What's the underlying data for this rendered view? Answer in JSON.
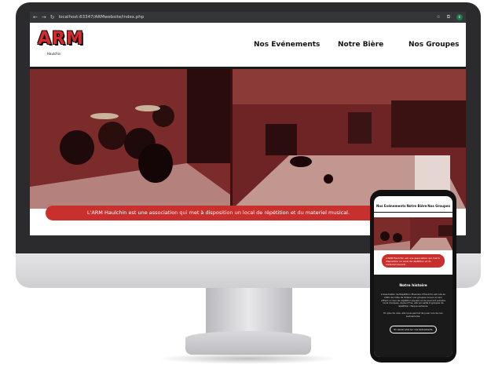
{
  "browser": {
    "url": "localhost:63347/ARMwebsite/index.php",
    "nav_icons": [
      "back-icon",
      "forward-icon",
      "reload-icon"
    ],
    "profile_initial": "c"
  },
  "site": {
    "logo": "ARM",
    "logo_sub": "Haulchin",
    "nav": [
      "Nos Evénements",
      "Notre Bière",
      "Nos Groupes"
    ],
    "banner": "L'ARM Haulchin est une association qui met à disposition un local de répétition et du materiel musical.",
    "accent": "#c8302e",
    "hero_tint": "#7a2a2a"
  },
  "mobile": {
    "nav": [
      "Nos Evénements",
      "Notre Bière",
      "Nos Groupes"
    ],
    "banner": "L'ARM Haulchin est une association qui met à disposition un local de répétition et du materiel musical.",
    "section_title": "Notre histoire",
    "para1": "L'Association de Répétition Musicale d'Haulchin est née en 2020 de l'idée de fédérer nos groupes locaux en leur offrant un lieu de répétition équipé où ils pourront prendre leurs marques. Aujourd'hui, elle accueille 6 groupes de répétition chaque semaine.",
    "para2": "En plus de cela, elle nous permet de jouer lors de nos événements.",
    "button": "En savoir plus sur nos événements"
  }
}
